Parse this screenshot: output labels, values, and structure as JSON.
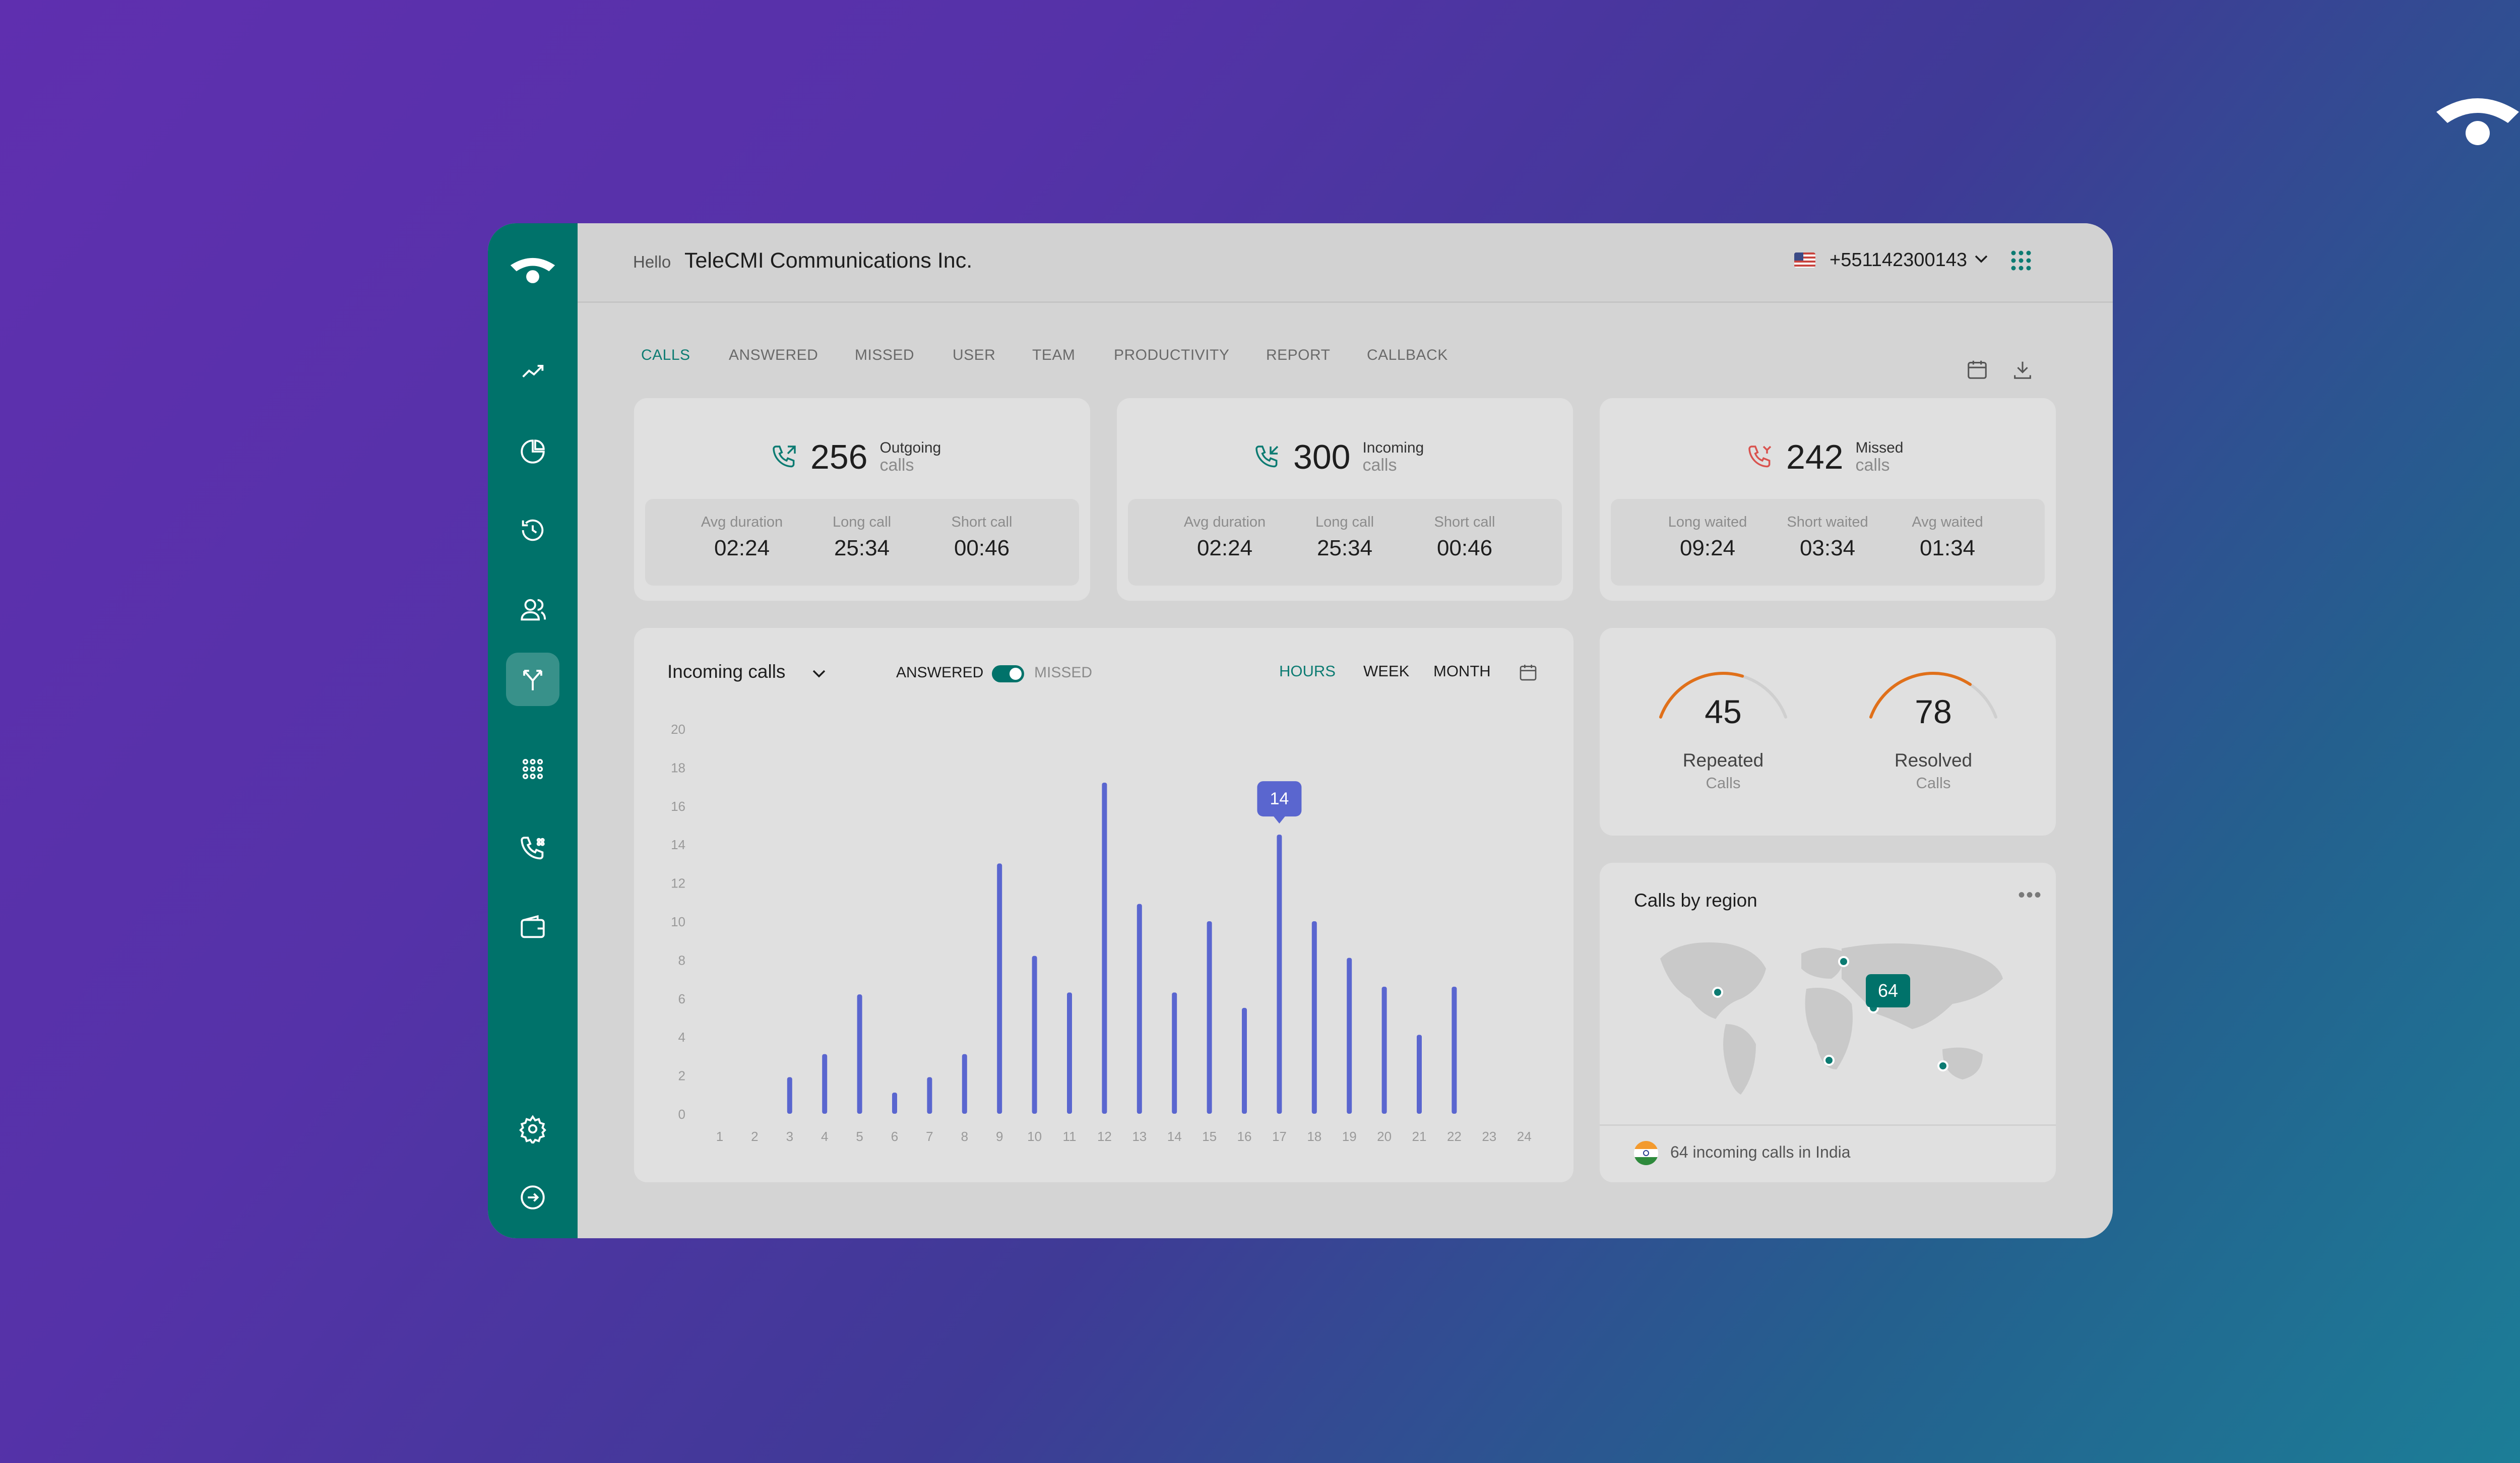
{
  "header": {
    "greeting": "Hello",
    "org_name": "TeleCMI Communications Inc.",
    "phone_number": "+551142300143"
  },
  "sidebar": {
    "items": [
      "trend-icon",
      "pie-chart-icon",
      "history-icon",
      "users-icon",
      "routing-icon",
      "dialpad-icon",
      "phone-settings-icon",
      "wallet-icon",
      "gear-icon",
      "logout-icon"
    ],
    "active": "routing-icon"
  },
  "tabs": [
    "CALLS",
    "ANSWERED",
    "MISSED",
    "USER",
    "TEAM",
    "PRODUCTIVITY",
    "REPORT",
    "CALLBACK"
  ],
  "active_tab": "CALLS",
  "stats": [
    {
      "number": "256",
      "label1": "Outgoing",
      "label2": "calls",
      "subs": [
        {
          "k": "Avg duration",
          "v": "02:24"
        },
        {
          "k": "Long call",
          "v": "25:34"
        },
        {
          "k": "Short call",
          "v": "00:46"
        }
      ]
    },
    {
      "number": "300",
      "label1": "Incoming",
      "label2": "calls",
      "subs": [
        {
          "k": "Avg duration",
          "v": "02:24"
        },
        {
          "k": "Long call",
          "v": "25:34"
        },
        {
          "k": "Short call",
          "v": "00:46"
        }
      ]
    },
    {
      "number": "242",
      "label1": "Missed",
      "label2": "calls",
      "subs": [
        {
          "k": "Long waited",
          "v": "09:24"
        },
        {
          "k": "Short waited",
          "v": "03:34"
        },
        {
          "k": "Avg waited",
          "v": "01:34"
        }
      ]
    }
  ],
  "chart_panel": {
    "dropdown": "Incoming calls",
    "toggle_on": "ANSWERED",
    "toggle_off": "MISSED",
    "ranges": [
      "HOURS",
      "WEEK",
      "MONTH"
    ],
    "active_range": "HOURS",
    "tooltip": "14"
  },
  "chart_data": {
    "type": "bar",
    "x": [
      1,
      2,
      3,
      4,
      5,
      6,
      7,
      8,
      9,
      10,
      11,
      12,
      13,
      14,
      15,
      16,
      17,
      18,
      19,
      20,
      21,
      22,
      23,
      24
    ],
    "values": [
      0,
      0,
      1.9,
      3.1,
      6.2,
      1.1,
      1.9,
      3.1,
      13,
      8.2,
      6.3,
      17.2,
      10.9,
      6.3,
      10,
      5.5,
      14.5,
      10,
      8.1,
      6.6,
      4.1,
      6.6,
      0,
      0
    ],
    "ylim": [
      0,
      20
    ],
    "yticks": [
      0,
      2,
      4,
      6,
      8,
      10,
      12,
      14,
      16,
      18,
      20
    ],
    "highlight": {
      "x": 17,
      "label": "14"
    },
    "bar_color": "#5a66cf"
  },
  "gauges": [
    {
      "value": "45",
      "title": "Repeated",
      "sub": "Calls",
      "fraction": 0.62
    },
    {
      "value": "78",
      "title": "Resolved",
      "sub": "Calls",
      "fraction": 0.74
    }
  ],
  "region": {
    "title": "Calls by region",
    "marker_value": "64",
    "footer": "64 incoming calls in India"
  },
  "colors": {
    "accent": "#00726a",
    "accent_text": "#0c7b72",
    "bar": "#5a66cf",
    "missed": "#d9534f",
    "gauge": "#e0701a"
  }
}
